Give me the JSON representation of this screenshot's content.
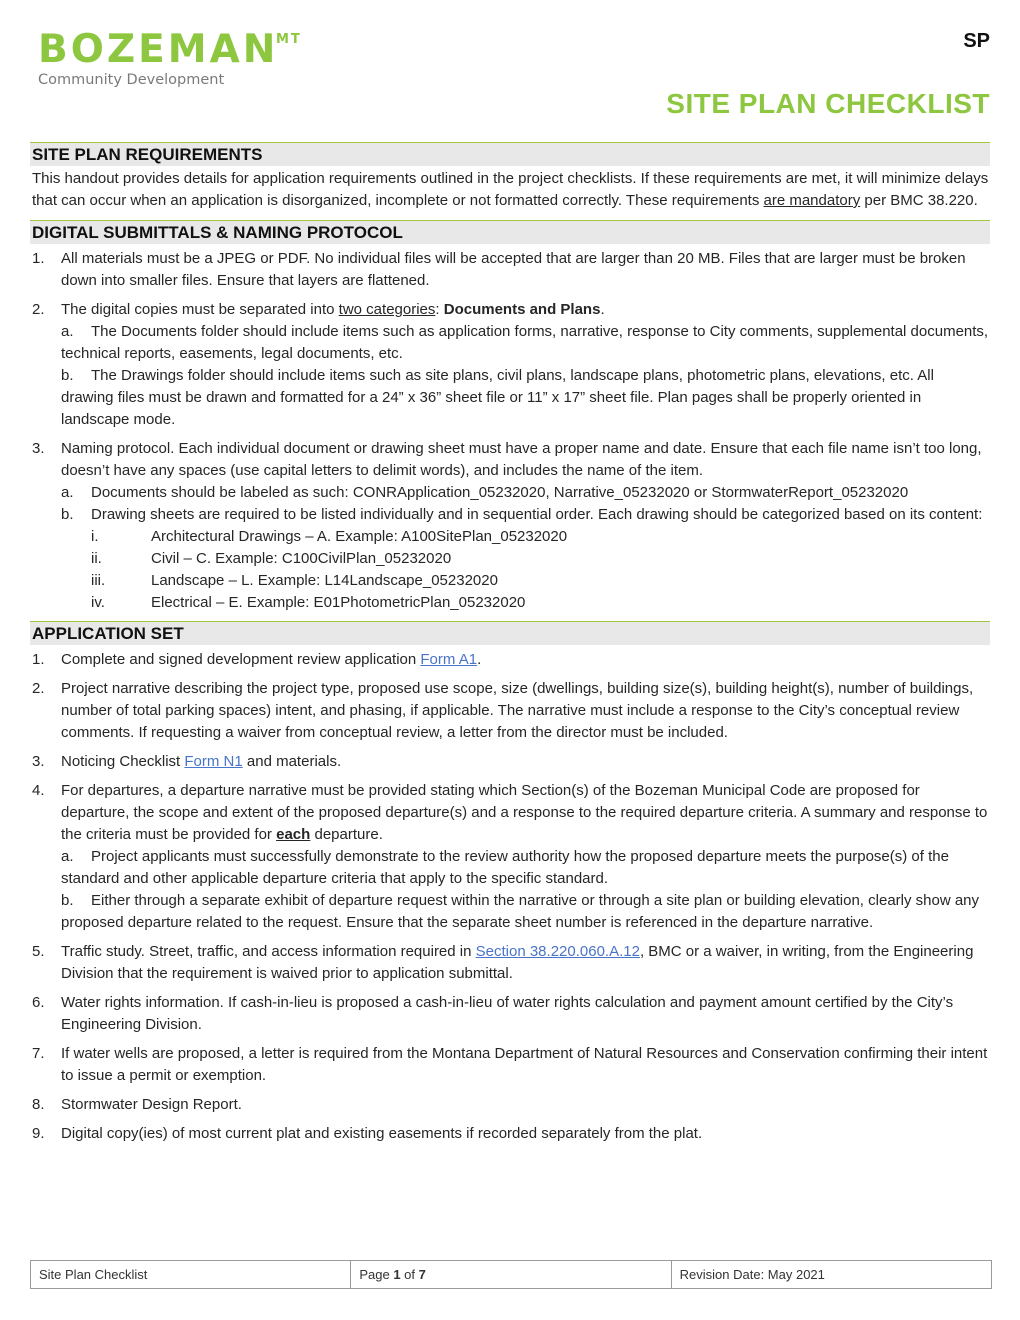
{
  "header": {
    "logo_word": "BOZEMAN",
    "logo_superscript": "MT",
    "logo_subtitle": "Community Development",
    "doc_code": "SP",
    "doc_title": "SITE PLAN CHECKLIST"
  },
  "colors": {
    "accent": "#8dc63f",
    "rule": "#a2c83f",
    "section_bg": "#e8e8e8",
    "link": "#4a74c9"
  },
  "sections": {
    "requirements": {
      "title": "SITE PLAN REQUIREMENTS",
      "text_before": "This handout provides details for application requirements outlined in the project checklists. If these requirements are met, it will minimize delays that can occur when an application is disorganized, incomplete or not formatted correctly. These requirements ",
      "underlined": "are mandatory",
      "text_after": " per BMC 38.220."
    },
    "digital": {
      "title": "DIGITAL SUBMITTALS & NAMING PROTOCOL",
      "item1": {
        "num": "1.",
        "text": "All materials must be a JPEG or PDF. No individual files will be accepted that are larger than 20 MB. Files that are larger must be broken down into smaller files. Ensure that layers are flattened."
      },
      "item2": {
        "num": "2.",
        "text_before": "The digital copies must be separated into ",
        "underlined": "two categories",
        "colon": ": ",
        "bold": "Documents and Plans",
        "end": ".",
        "sub_a_letter": "a.",
        "sub_a": "The Documents folder should include items such as application forms, narrative, response to City comments, supplemental documents, technical reports, easements, legal documents, etc.",
        "sub_b_letter": "b.",
        "sub_b": "The Drawings folder should include items such as site plans, civil plans, landscape plans, photometric plans, elevations, etc. All drawing files must be drawn and formatted for a 24” x 36” sheet file or 11” x 17” sheet file. Plan pages shall be properly oriented in landscape mode."
      },
      "item3": {
        "num": "3.",
        "text": "Naming protocol. Each individual document or drawing sheet must have a proper name and date. Ensure that each file name isn’t too long, doesn’t have any spaces (use capital letters to delimit words), and includes the name of the item.",
        "sub_a_letter": "a.",
        "sub_a": "Documents should be labeled as such: CONRApplication_05232020, Narrative_05232020 or StormwaterReport_05232020",
        "sub_b_letter": "b.",
        "sub_b": "Drawing sheets are required to be listed individually and in sequential order. Each drawing should be categorized based on its content:",
        "roman": [
          {
            "r": "i.",
            "text": "Architectural Drawings – A. Example: A100SitePlan_05232020"
          },
          {
            "r": "ii.",
            "text": "Civil – C. Example: C100CivilPlan_05232020"
          },
          {
            "r": "iii.",
            "text": "Landscape – L. Example: L14Landscape_05232020"
          },
          {
            "r": "iv.",
            "text": "Electrical – E. Example: E01PhotometricPlan_05232020"
          }
        ]
      }
    },
    "application": {
      "title": "APPLICATION SET",
      "item1": {
        "num": "1.",
        "text_before": "Complete and signed development review application ",
        "link": "Form A1",
        "text_after": "."
      },
      "item2": {
        "num": "2.",
        "text": "Project narrative describing the project type, proposed use scope, size (dwellings, building size(s), building height(s), number of buildings, number of total parking spaces) intent, and phasing, if applicable. The narrative must include a response to the City’s conceptual review comments. If requesting a waiver from conceptual review, a letter from the director must be included."
      },
      "item3": {
        "num": "3.",
        "text_before": "Noticing Checklist ",
        "link": "Form N1",
        "text_after": " and materials."
      },
      "item4": {
        "num": "4.",
        "text_before": "For departures, a departure narrative must be provided stating which Section(s) of the Bozeman Municipal Code are proposed for departure, the scope and extent of the proposed departure(s) and a response to the required departure criteria. A summary and response to the criteria must be provided for ",
        "bold_underlined": "each",
        "text_after": " departure.",
        "sub_a_letter": "a.",
        "sub_a": "Project applicants must successfully demonstrate to the review authority how the proposed departure meets the purpose(s) of the standard and other applicable departure criteria that apply to the specific standard.",
        "sub_b_letter": "b.",
        "sub_b": "Either through a separate exhibit of departure request within the narrative or through a site plan or building elevation, clearly show any proposed departure related to the request. Ensure that the separate sheet number is referenced in the departure narrative."
      },
      "item5": {
        "num": "5.",
        "text_before": "Traffic study. Street, traffic, and access information required in ",
        "link": "Section 38.220.060.A.12",
        "text_after": ", BMC or a waiver, in writing, from the Engineering Division that the requirement is waived prior to application submittal."
      },
      "item6": {
        "num": "6.",
        "text": "Water rights information. If cash-in-lieu is proposed a cash-in-lieu of water rights calculation and payment amount certified by the City’s Engineering Division."
      },
      "item7": {
        "num": "7.",
        "text": "If water wells are proposed, a letter is required from the Montana Department of Natural Resources and Conservation confirming their intent to issue a permit or exemption."
      },
      "item8": {
        "num": "8.",
        "text": "Stormwater Design Report."
      },
      "item9": {
        "num": "9.",
        "text": "Digital copy(ies) of most current plat and existing easements if recorded separately from the plat."
      }
    }
  },
  "footer": {
    "doc_name": "Site Plan Checklist",
    "page_prefix": "Page ",
    "page_current": "1",
    "page_of": " of ",
    "page_total": "7",
    "revision": "Revision Date: May 2021"
  }
}
